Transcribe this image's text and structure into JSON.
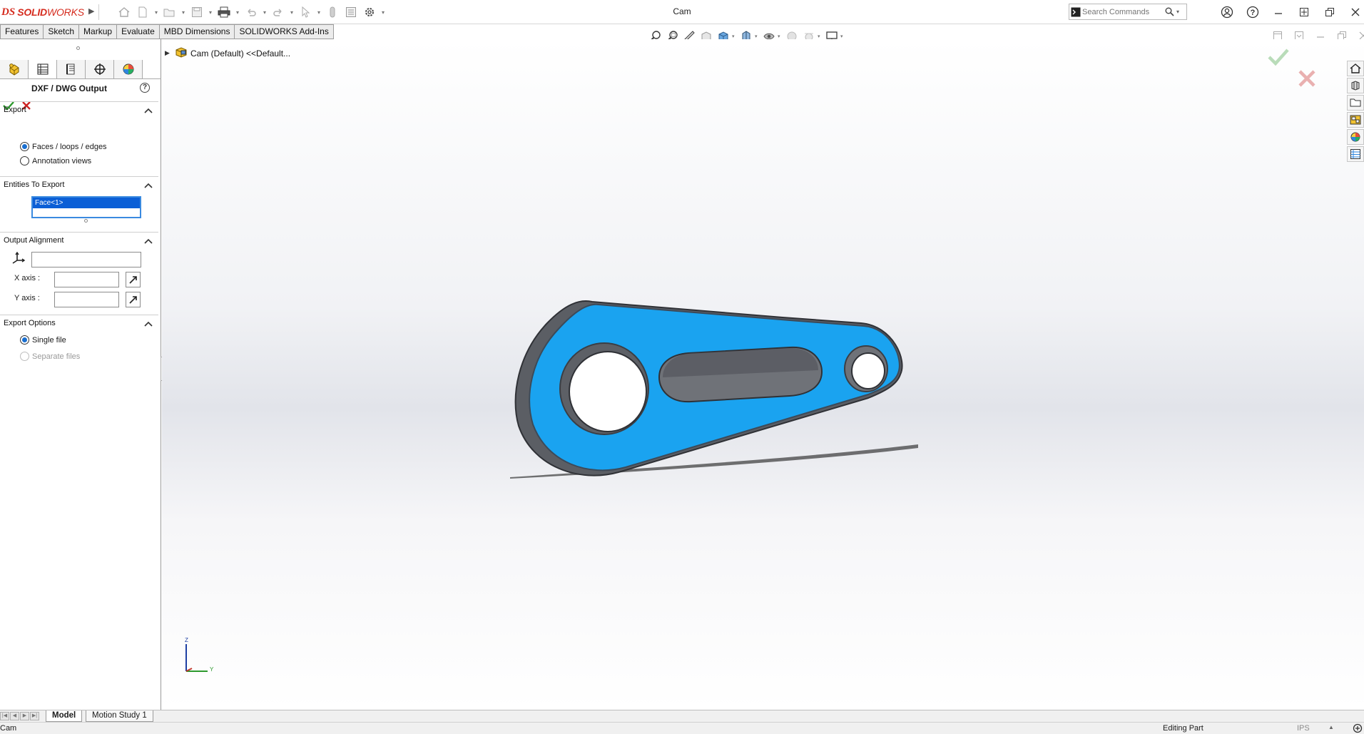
{
  "app": {
    "brand_prefix": "DS",
    "brand_name_bold": "SOLID",
    "brand_name_rest": "WORKS",
    "document_title": "Cam"
  },
  "search": {
    "placeholder": "Search Commands"
  },
  "command_tabs": [
    {
      "label": "Features"
    },
    {
      "label": "Sketch"
    },
    {
      "label": "Markup"
    },
    {
      "label": "Evaluate"
    },
    {
      "label": "MBD Dimensions"
    },
    {
      "label": "SOLIDWORKS Add-Ins"
    }
  ],
  "property_manager": {
    "title": "DXF / DWG Output",
    "help_label": "?",
    "sections": {
      "export": {
        "label": "Export",
        "options": [
          {
            "label": "Faces / loops / edges",
            "selected": true
          },
          {
            "label": "Annotation views",
            "selected": false
          }
        ]
      },
      "entities": {
        "label": "Entities To Export",
        "items": [
          "Face<1>"
        ]
      },
      "alignment": {
        "label": "Output Alignment",
        "origin_value": "",
        "x_axis_label": "X axis :",
        "x_axis_value": "",
        "y_axis_label": "Y axis :",
        "y_axis_value": ""
      },
      "options": {
        "label": "Export Options",
        "items": [
          {
            "label": "Single file",
            "selected": true,
            "enabled": true
          },
          {
            "label": "Separate files",
            "selected": false,
            "enabled": false
          }
        ]
      }
    }
  },
  "feature_tree": {
    "root_label": "Cam  (Default) <<Default..."
  },
  "triad": {
    "z": "Z",
    "y": "Y"
  },
  "bottom_tabs": [
    {
      "label": "Model",
      "active": true
    },
    {
      "label": "Motion Study 1",
      "active": false
    }
  ],
  "status": {
    "left": "Cam",
    "mode": "Editing Part",
    "units": "IPS",
    "units_arrow": "▲"
  },
  "colors": {
    "brand_red": "#d52b1e",
    "selection_blue": "#0b5fd6",
    "face_highlight": "#1aa3f0",
    "part_gray": "#6f7278",
    "ok_green": "#2e9a2e",
    "cancel_red": "#cc2222"
  }
}
